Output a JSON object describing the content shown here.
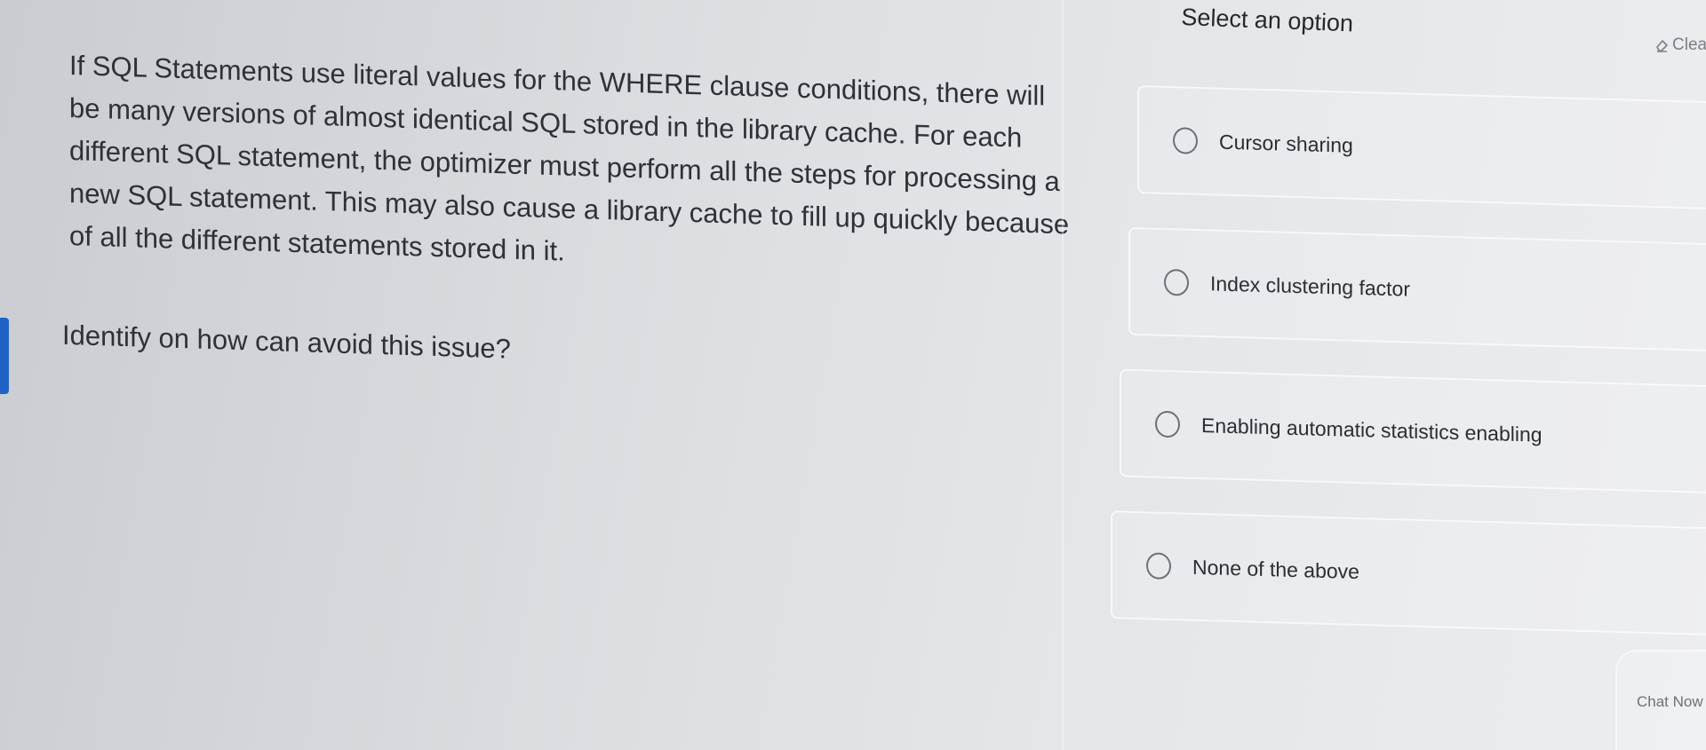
{
  "question": {
    "body": "If SQL Statements use literal values for the WHERE clause conditions, there will be many versions of almost identical SQL stored in the library cache. For each different SQL statement, the optimizer must perform all the steps for processing a new SQL statement. This may also cause a library cache to fill up quickly because of all the different statements stored in it.",
    "prompt": "Identify on how can avoid this issue?"
  },
  "answer_panel": {
    "heading": "Select an option",
    "clear_label": "Clea",
    "options": [
      {
        "label": "Cursor sharing"
      },
      {
        "label": "Index clustering factor"
      },
      {
        "label": "Enabling automatic statistics enabling"
      },
      {
        "label": "None of the above"
      }
    ]
  },
  "chat": {
    "label": "Chat Now"
  },
  "icons": {
    "clear": "eraser-icon",
    "radio": "radio-button-icon"
  },
  "colors": {
    "accent": "#1f63c7",
    "text": "#2f3136",
    "muted": "#7b7f86"
  }
}
